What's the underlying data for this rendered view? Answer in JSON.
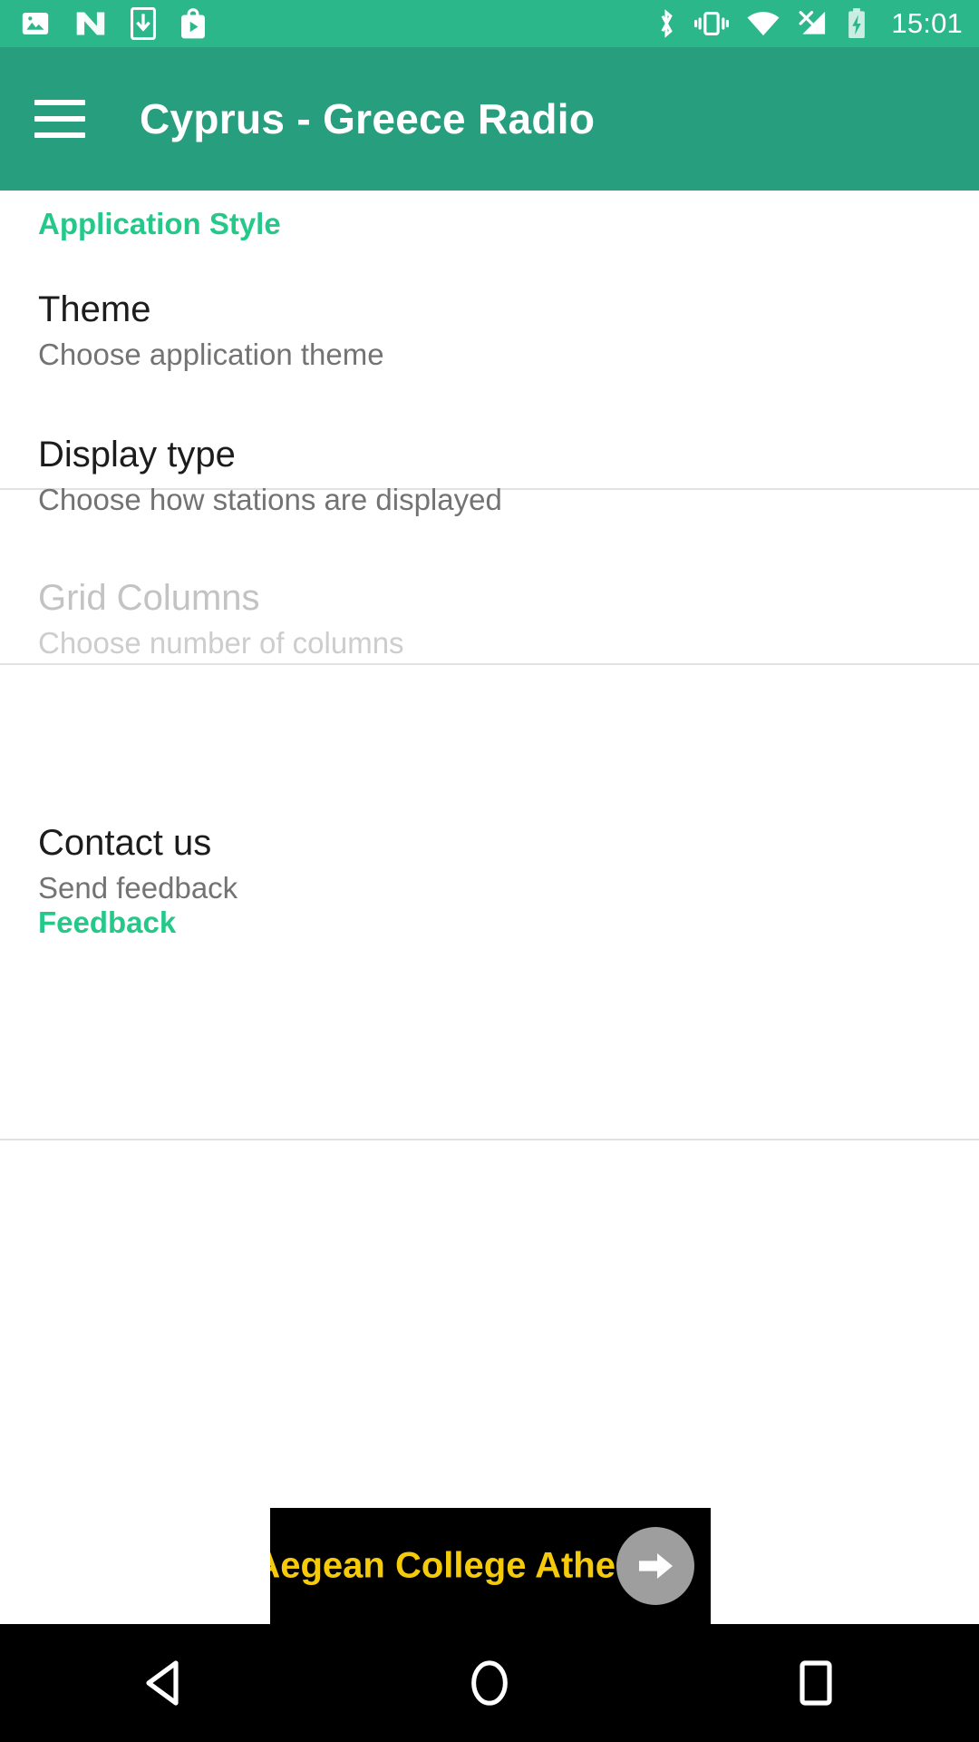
{
  "status_bar": {
    "background": "#2BB789",
    "time": "15:01",
    "left_icons": [
      {
        "name": "photo-icon",
        "label": "Screenshot"
      },
      {
        "name": "android-n-icon",
        "label": "Android N"
      },
      {
        "name": "download-to-device-icon",
        "label": "Download"
      },
      {
        "name": "play-store-icon",
        "label": "Play Store"
      }
    ],
    "right_icons": [
      {
        "name": "bluetooth-icon",
        "label": "Bluetooth"
      },
      {
        "name": "vibrate-icon",
        "label": "Vibrate"
      },
      {
        "name": "wifi-icon",
        "label": "Wi-Fi"
      },
      {
        "name": "cellular-no-service-icon",
        "label": "No SIM"
      },
      {
        "name": "battery-charging-icon",
        "label": "Charging"
      }
    ]
  },
  "app_bar": {
    "background": "#279E7E",
    "title": "Cyprus - Greece Radio",
    "menu_icon": "hamburger-icon"
  },
  "settings": {
    "accent_color": "#24C98A",
    "sections": [
      {
        "header": "Application Style",
        "items": [
          {
            "title": "Theme",
            "summary": "Choose application theme",
            "enabled": true
          },
          {
            "title": "Display type",
            "summary": "Choose how stations are displayed",
            "enabled": true
          },
          {
            "title": "Grid Columns",
            "summary": "Choose number of columns",
            "enabled": false
          }
        ]
      },
      {
        "header": "Feedback",
        "items": [
          {
            "title": "Contact us",
            "summary": "Send feedback",
            "enabled": true
          }
        ]
      }
    ]
  },
  "ad": {
    "headline": "Aegean College Athens",
    "background": "#000000",
    "text_color": "#F5CA0B",
    "cta_icon": "arrow-right-icon",
    "close_badge": "close-icon",
    "info_badge": "adchoices-info-icon"
  },
  "nav_bar": {
    "background": "#000000",
    "buttons": [
      {
        "name": "back-button",
        "icon": "back-triangle-icon"
      },
      {
        "name": "home-button",
        "icon": "home-circle-icon"
      },
      {
        "name": "recents-button",
        "icon": "recents-square-icon"
      }
    ]
  }
}
